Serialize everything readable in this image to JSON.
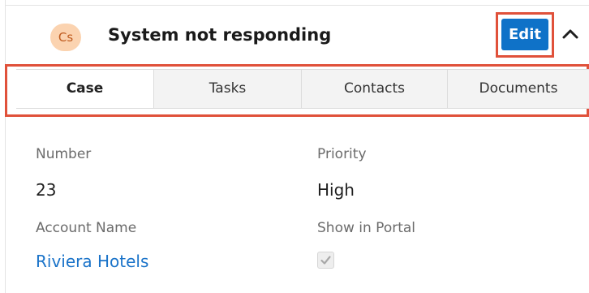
{
  "record": {
    "avatar_text": "Cs",
    "title": "System not responding",
    "edit_label": "Edit",
    "avatar_color": "#fbd3b0",
    "edit_color": "#0f72c8",
    "highlight_color": "#e0513a"
  },
  "tabs": [
    {
      "label": "Case",
      "active": true
    },
    {
      "label": "Tasks",
      "active": false
    },
    {
      "label": "Contacts",
      "active": false
    },
    {
      "label": "Documents",
      "active": false
    }
  ],
  "fields": {
    "number": {
      "label": "Number",
      "value": "23"
    },
    "priority": {
      "label": "Priority",
      "value": "High"
    },
    "account_name": {
      "label": "Account Name",
      "value": "Riviera Hotels"
    },
    "show_in_portal": {
      "label": "Show in Portal",
      "checked": true
    }
  },
  "icons": {
    "collapse": "chevron-up-icon",
    "checkbox": "checkmark-icon"
  }
}
